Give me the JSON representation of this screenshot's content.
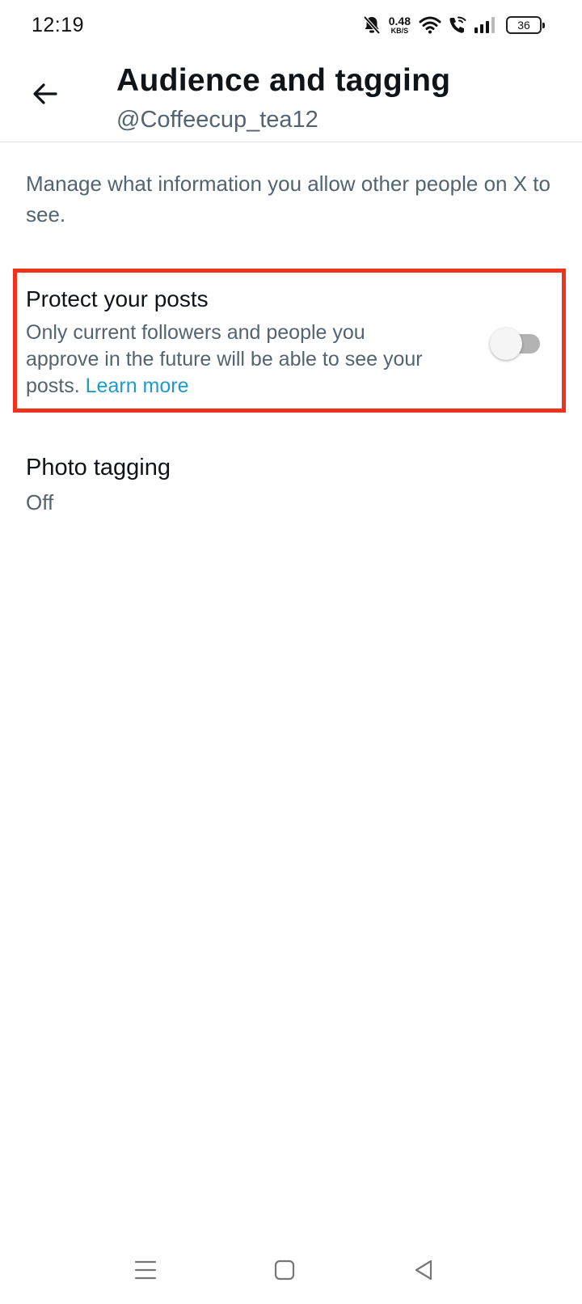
{
  "status_bar": {
    "time": "12:19",
    "net_speed_value": "0.48",
    "net_speed_unit": "KB/S",
    "battery": "36",
    "icons": [
      "mute-bell-icon",
      "wifi-icon",
      "wifi-calling-icon",
      "signal-icon",
      "battery-icon"
    ]
  },
  "header": {
    "title": "Audience and tagging",
    "handle": "@Coffeecup_tea12",
    "back_icon": "arrow-left-icon"
  },
  "intro": {
    "text": "Manage what information you allow other people on X to see."
  },
  "protect_posts": {
    "title": "Protect your posts",
    "description": "Only current followers and people you approve in the future will be able to see your posts.",
    "link": "Learn more",
    "enabled": false,
    "highlight_color": "#f0311c"
  },
  "photo_tagging": {
    "title": "Photo tagging",
    "value": "Off"
  },
  "nav_bar": {
    "icons": [
      "menu-icon",
      "home-square-icon",
      "back-triangle-icon"
    ]
  },
  "colors": {
    "primary_text": "#0f1419",
    "secondary_text": "#536471",
    "link": "#1d9bd0"
  }
}
